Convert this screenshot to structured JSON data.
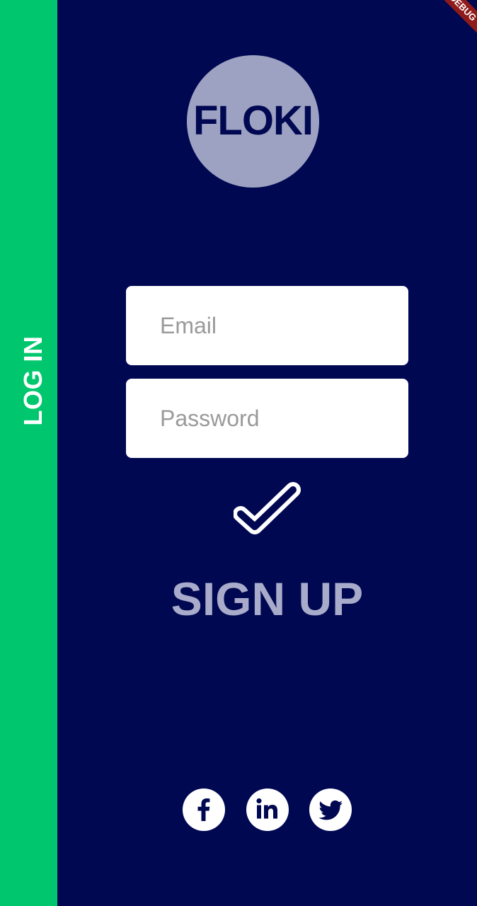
{
  "app": {
    "logo_text": "FLOKI",
    "debug_banner": "DEBUG"
  },
  "side_tab": {
    "label": "LOG IN"
  },
  "form": {
    "email_placeholder": "Email",
    "password_placeholder": "Password",
    "submit_icon": "checkmark-icon"
  },
  "signup": {
    "label": "SIGN UP"
  },
  "social": [
    {
      "name": "facebook",
      "icon": "facebook-icon"
    },
    {
      "name": "linkedin",
      "icon": "linkedin-icon"
    },
    {
      "name": "twitter",
      "icon": "twitter-icon"
    }
  ],
  "colors": {
    "background": "#000852",
    "side_tab": "#00C76D",
    "logo_circle": "#9EA2C2",
    "signup_text": "#A8ABC9",
    "field_background": "#FFFFFF",
    "debug_banner": "#8F1A1A"
  }
}
